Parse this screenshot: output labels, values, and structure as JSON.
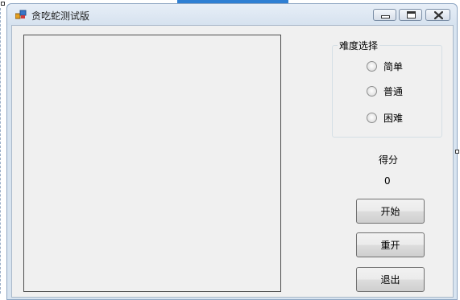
{
  "window": {
    "title": "贪吃蛇测试版",
    "icon": "app-form-icon",
    "controls": [
      "minimize-icon",
      "maximize-icon",
      "close-icon"
    ]
  },
  "difficulty": {
    "legend": "难度选择",
    "options": [
      "简单",
      "普通",
      "困难"
    ]
  },
  "score": {
    "label": "得分",
    "value": "0"
  },
  "buttons": {
    "start": "开始",
    "restart": "重开",
    "exit": "退出"
  },
  "colors": {
    "accent": "#2f7fd3",
    "window_frame": "#d8e4f0",
    "client_bg": "#f0f0f0"
  }
}
